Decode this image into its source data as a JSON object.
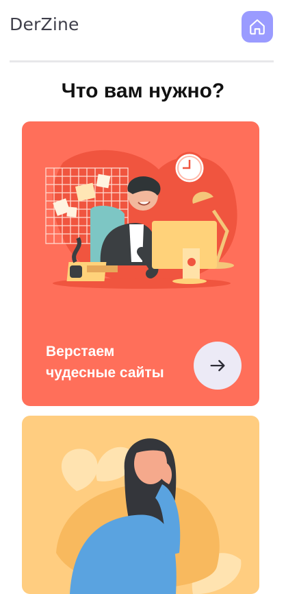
{
  "header": {
    "logo": "DerZine",
    "home_icon": "home-icon"
  },
  "page": {
    "title": "Что вам нужно?"
  },
  "cards": [
    {
      "line1": "Верстаем",
      "line2": "чудесные сайты",
      "color": "#ff6f5a",
      "button_icon": "arrow-right-icon",
      "illustration": "man-at-computer"
    },
    {
      "color": "#ffcd80",
      "illustration": "tired-woman"
    }
  ]
}
